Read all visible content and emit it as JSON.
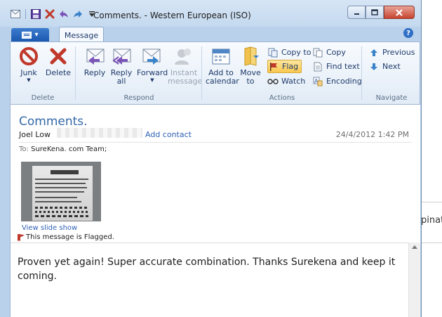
{
  "window": {
    "title": "Comments. - Western European (ISO)",
    "tab_label": "Message"
  },
  "ribbon": {
    "groups": {
      "delete": "Delete",
      "respond": "Respond",
      "actions": "Actions",
      "navigate": "Navigate"
    },
    "buttons": {
      "junk": "Junk",
      "delete": "Delete",
      "reply": "Reply",
      "reply_all_1": "Reply",
      "reply_all_2": "all",
      "forward": "Forward",
      "instant_message_1": "Instant",
      "instant_message_2": "message",
      "add_to_calendar_1": "Add to",
      "add_to_calendar_2": "calendar",
      "move_to_1": "Move",
      "move_to_2": "to",
      "copy_to": "Copy to",
      "flag": "Flag",
      "watch": "Watch",
      "copy": "Copy",
      "find_text": "Find text",
      "encoding": "Encoding",
      "previous": "Previous",
      "next": "Next"
    }
  },
  "message": {
    "subject": "Comments.",
    "sender_name": "Joel Low",
    "add_contact": "Add contact",
    "date": "24/4/2012 1:42 PM",
    "to_label": "To:",
    "to_value": "SureKena. com Team;",
    "view_slide_show": "View slide show",
    "flag_notice": "This message is Flagged.",
    "body": "Proven yet again! Super accurate combination. Thanks Surekena and keep it coming."
  },
  "background": {
    "partial_text": "pinat"
  },
  "colors": {
    "accent": "#3468a6",
    "link": "#2f62b5",
    "ribbon_text": "#1e3a6b",
    "flag_highlight": "#f9c84e",
    "file_button": "#1b58b0"
  }
}
